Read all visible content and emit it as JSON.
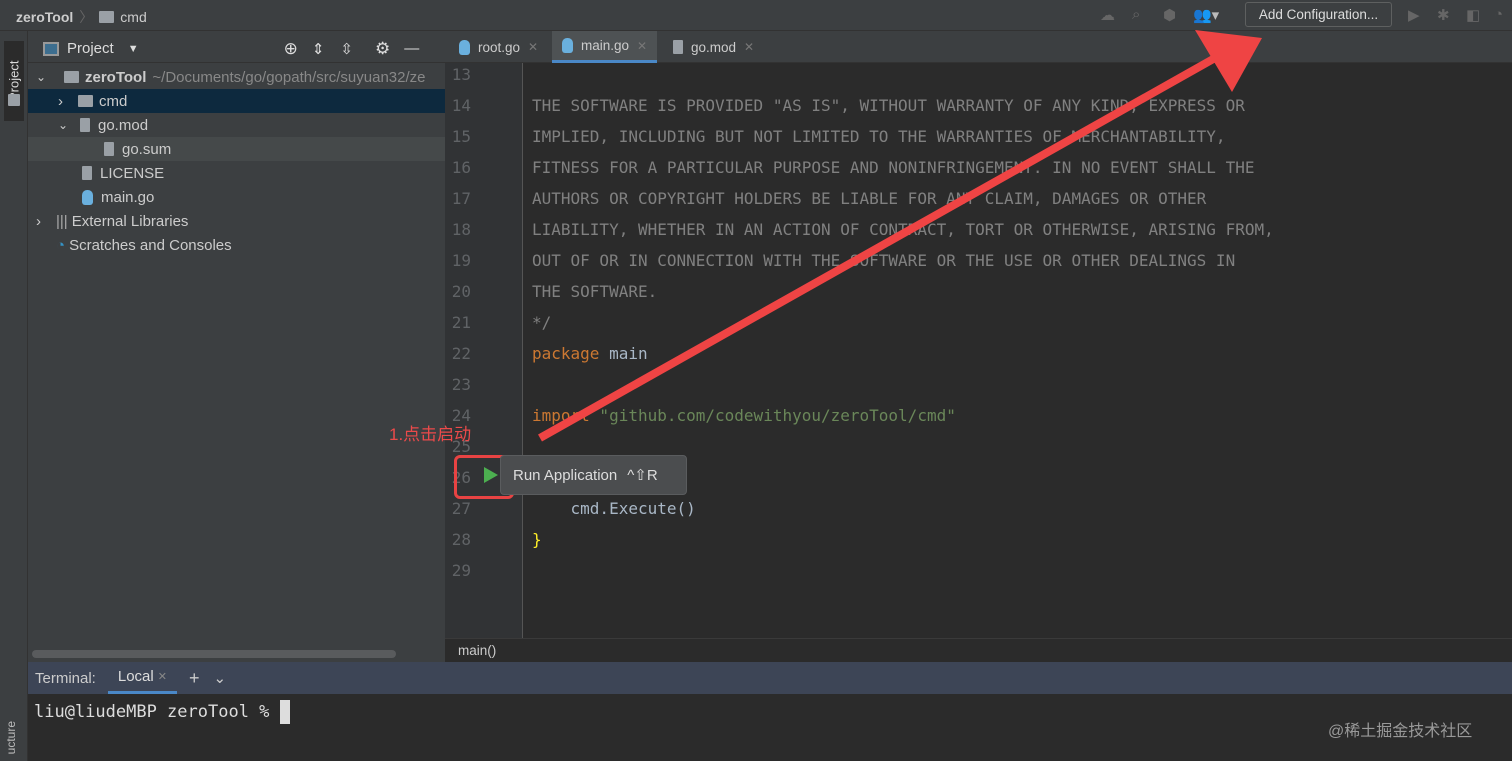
{
  "titlebar": {
    "project": "zeroTool",
    "folder": "cmd",
    "add_config": "Add Configuration..."
  },
  "strip": {
    "project_label": "Project",
    "structure_label": "ucture"
  },
  "project_panel": {
    "title": "Project",
    "items": [
      {
        "label": "zeroTool",
        "path": "~/Documents/go/gopath/src/suyuan32/ze"
      },
      {
        "label": "cmd"
      },
      {
        "label": "go.mod"
      },
      {
        "label": "go.sum"
      },
      {
        "label": "LICENSE"
      },
      {
        "label": "main.go"
      },
      {
        "label": "External Libraries"
      },
      {
        "label": "Scratches and Consoles"
      }
    ]
  },
  "tabs": [
    {
      "label": "root.go"
    },
    {
      "label": "main.go",
      "active": true
    },
    {
      "label": "go.mod"
    }
  ],
  "editor": {
    "lines": [
      {
        "n": "13",
        "t": ""
      },
      {
        "n": "14",
        "t": "THE SOFTWARE IS PROVIDED \"AS IS\", WITHOUT WARRANTY OF ANY KIND, EXPRESS OR"
      },
      {
        "n": "15",
        "t": "IMPLIED, INCLUDING BUT NOT LIMITED TO THE WARRANTIES OF MERCHANTABILITY,"
      },
      {
        "n": "16",
        "t": "FITNESS FOR A PARTICULAR PURPOSE AND NONINFRINGEMENT. IN NO EVENT SHALL THE"
      },
      {
        "n": "17",
        "t": "AUTHORS OR COPYRIGHT HOLDERS BE LIABLE FOR ANY CLAIM, DAMAGES OR OTHER"
      },
      {
        "n": "18",
        "t": "LIABILITY, WHETHER IN AN ACTION OF CONTRACT, TORT OR OTHERWISE, ARISING FROM,"
      },
      {
        "n": "19",
        "t": "OUT OF OR IN CONNECTION WITH THE SOFTWARE OR THE USE OR OTHER DEALINGS IN"
      },
      {
        "n": "20",
        "t": "THE SOFTWARE."
      },
      {
        "n": "21",
        "t": "*/"
      },
      {
        "n": "22",
        "kw": "package",
        "rest": " main"
      },
      {
        "n": "23",
        "t": ""
      },
      {
        "n": "24",
        "kw": "import",
        "str": " \"github.com/codewithyou/zeroTool/cmd\""
      },
      {
        "n": "25",
        "t": ""
      },
      {
        "n": "26",
        "t": ""
      },
      {
        "n": "27",
        "obj": "    cmd.",
        "fn": "Execute",
        "rest": "()"
      },
      {
        "n": "28",
        "brace": "}"
      },
      {
        "n": "29",
        "t": ""
      }
    ],
    "tooltip": {
      "label": "Run Application",
      "shortcut": "^⇧R"
    },
    "breadcrumb": "main()"
  },
  "annotation": "1.点击启动",
  "terminal": {
    "title": "Terminal:",
    "tab": "Local",
    "prompt": "liu@liudeMBP zeroTool % "
  },
  "watermark": "@稀土掘金技术社区",
  "colors": {
    "annotation": "#e84343",
    "keyword": "#cc7832",
    "string": "#6a8759",
    "selection": "#0d293e"
  }
}
